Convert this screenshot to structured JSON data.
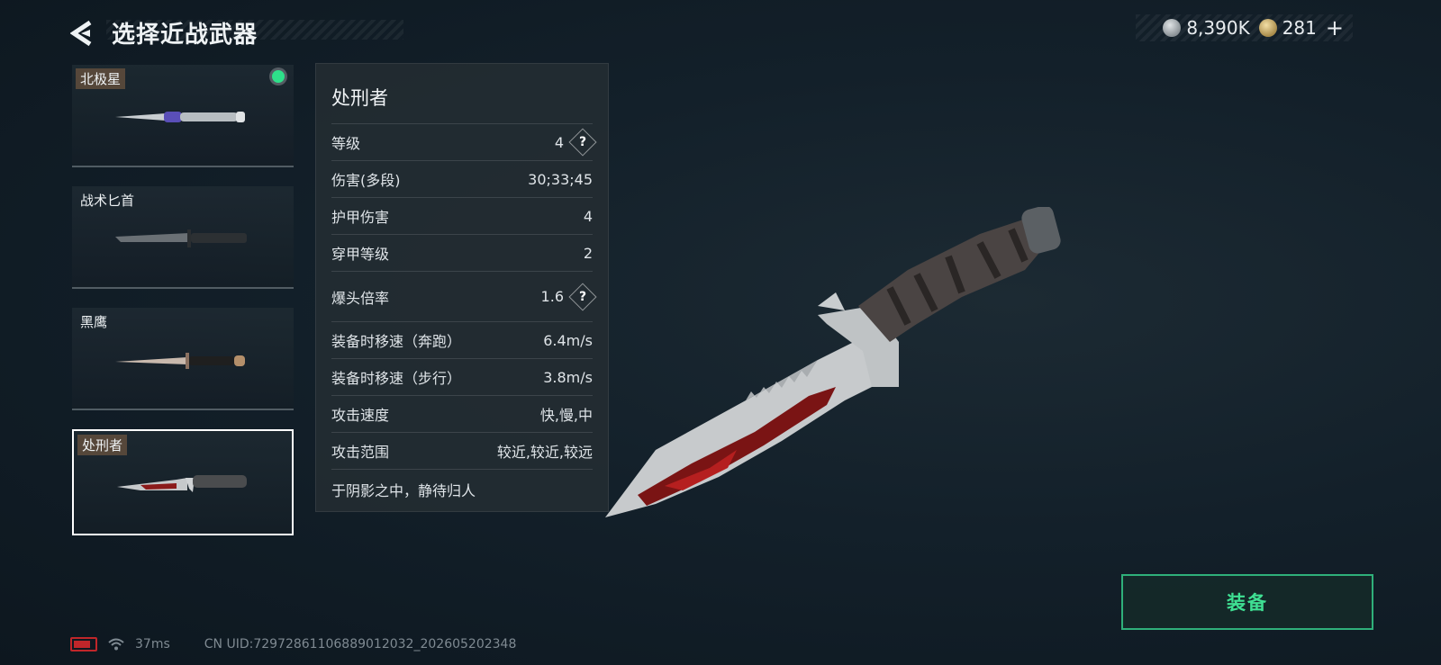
{
  "header": {
    "title": "选择近战武器"
  },
  "currency": {
    "silver": "8,390K",
    "gold": "281",
    "plus": "+"
  },
  "weapons": [
    {
      "name": "北极星",
      "equipped": true
    },
    {
      "name": "战术匕首"
    },
    {
      "name": "黑鹰"
    },
    {
      "name": "处刑者",
      "selected": true
    }
  ],
  "panel": {
    "weapon_name": "处刑者",
    "stats": [
      {
        "label": "等级",
        "value": "4",
        "help": true
      },
      {
        "label": "伤害(多段)",
        "value": "30;33;45"
      },
      {
        "label": "护甲伤害",
        "value": "4"
      },
      {
        "label": "穿甲等级",
        "value": "2"
      },
      {
        "label": "爆头倍率",
        "value": "1.6",
        "help": true
      },
      {
        "label": "装备时移速（奔跑）",
        "value": "6.4m/s"
      },
      {
        "label": "装备时移速（步行）",
        "value": "3.8m/s"
      },
      {
        "label": "攻击速度",
        "value": "快,慢,中"
      },
      {
        "label": "攻击范围",
        "value": "较近,较近,较远"
      }
    ],
    "description": "于阴影之中，静待归人",
    "help_glyph": "?"
  },
  "equip_button": {
    "label": "装备"
  },
  "status_bar": {
    "ping": "37ms",
    "uid": "CN UID:7297286110688901203​2_202605202348"
  },
  "colors": {
    "accent_green": "#3fe093",
    "equipped_dot": "#2ee08a",
    "battery": "#c0262a"
  }
}
